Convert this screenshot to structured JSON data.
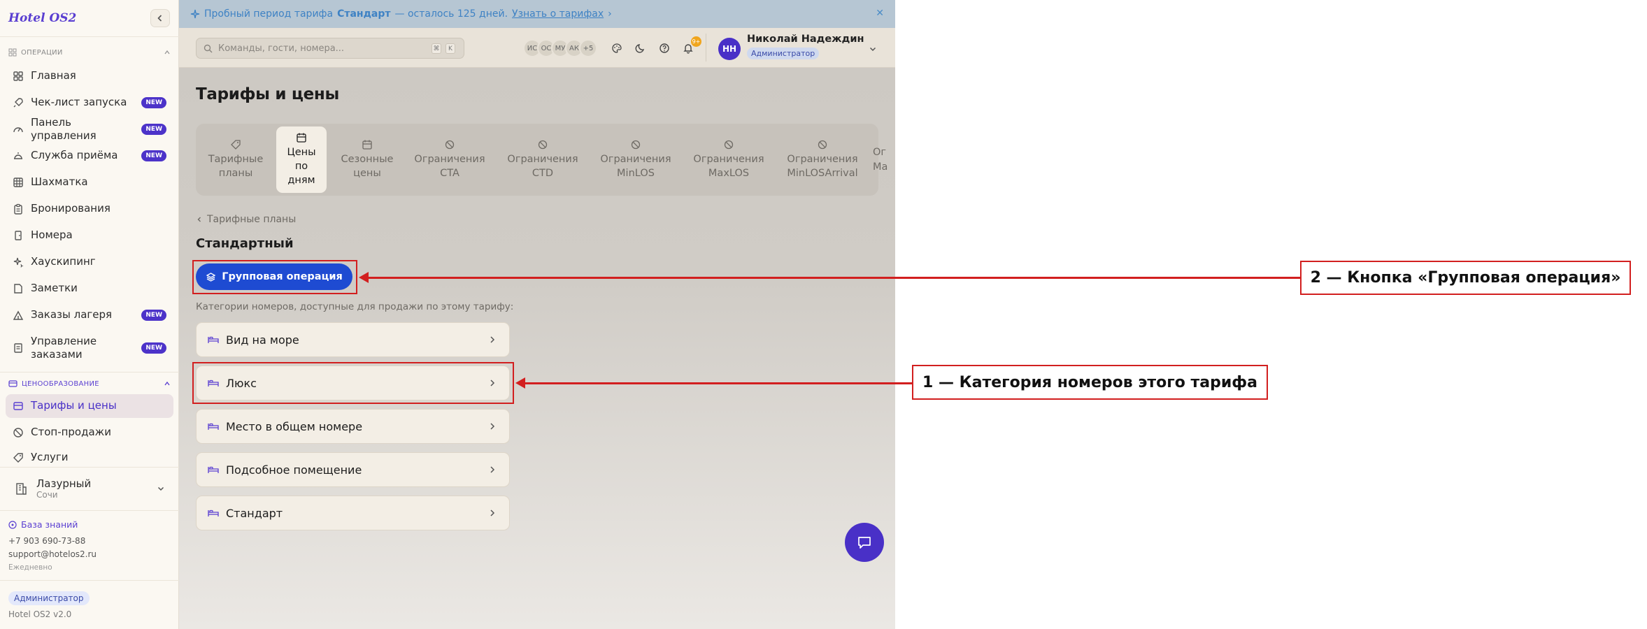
{
  "app": {
    "logo": "Hotel OS2",
    "version": "Hotel OS2 v2.0"
  },
  "sidebar": {
    "section_operations": "ОПЕРАЦИИ",
    "section_pricing": "ЦЕНООБРАЗОВАНИЕ",
    "items": [
      {
        "label": "Главная",
        "badge": "",
        "icon": "grid-icon"
      },
      {
        "label": "Чек-лист запуска",
        "badge": "NEW",
        "icon": "rocket-icon"
      },
      {
        "label": "Панель управления",
        "badge": "NEW",
        "icon": "gauge-icon"
      },
      {
        "label": "Служба приёма",
        "badge": "NEW",
        "icon": "bell-icon"
      },
      {
        "label": "Шахматка",
        "badge": "",
        "icon": "table-icon"
      },
      {
        "label": "Бронирования",
        "badge": "",
        "icon": "clipboard-icon"
      },
      {
        "label": "Номера",
        "badge": "",
        "icon": "door-icon"
      },
      {
        "label": "Хаускипинг",
        "badge": "",
        "icon": "sparkle-icon"
      },
      {
        "label": "Заметки",
        "badge": "",
        "icon": "note-icon"
      },
      {
        "label": "Заказы лагеря",
        "badge": "NEW",
        "icon": "tent-icon"
      },
      {
        "label": "Управление заказами",
        "badge": "NEW",
        "icon": "receipt-icon"
      }
    ],
    "pricing_items": [
      {
        "label": "Тарифы и цены",
        "icon": "card-icon"
      },
      {
        "label": "Стоп-продажи",
        "icon": "ban-icon"
      },
      {
        "label": "Услуги",
        "icon": "tag-icon"
      }
    ],
    "hotel": {
      "name": "Лазурный",
      "city": "Сочи"
    },
    "knowledge_base": "База знаний",
    "phone": "+7 903 690-73-88",
    "email": "support@hotelos2.ru",
    "schedule": "Ежедневно",
    "role": "Администратор"
  },
  "trial": {
    "prefix": "Пробный период тарифа",
    "plan": "Стандарт",
    "suffix": "— осталось 125 дней.",
    "link": "Узнать о тарифах"
  },
  "topbar": {
    "search_placeholder": "Команды, гости, номера...",
    "kbd1": "⌘",
    "kbd2": "K",
    "avatars": [
      "ИС",
      "ОС",
      "МУ",
      "АК",
      "+5"
    ],
    "notif_count": "9+",
    "user_initials": "НН",
    "user_name": "Николай Надеждин",
    "user_role": "Администратор"
  },
  "page": {
    "title": "Тарифы и цены",
    "tabs": [
      {
        "l1": "Тарифные",
        "l2": "планы",
        "l3": "",
        "icon": "tag-icon"
      },
      {
        "l1": "Цены",
        "l2": "по",
        "l3": "дням",
        "icon": "calendar-icon"
      },
      {
        "l1": "Сезонные",
        "l2": "цены",
        "l3": "",
        "icon": "calendar-icon"
      },
      {
        "l1": "Ограничения",
        "l2": "CTA",
        "l3": "",
        "icon": "ban-icon"
      },
      {
        "l1": "Ограничения",
        "l2": "CTD",
        "l3": "",
        "icon": "ban-icon"
      },
      {
        "l1": "Ограничения",
        "l2": "MinLOS",
        "l3": "",
        "icon": "ban-icon"
      },
      {
        "l1": "Ограничения",
        "l2": "MaxLOS",
        "l3": "",
        "icon": "ban-icon"
      },
      {
        "l1": "Ограничения",
        "l2": "MinLOSArrival",
        "l3": "",
        "icon": "ban-icon"
      },
      {
        "l1": "Ог",
        "l2": "Ма",
        "l3": "",
        "icon": ""
      }
    ],
    "breadcrumb": "Тарифные планы",
    "plan_name": "Стандартный",
    "group_button": "Групповая операция",
    "hint": "Категории номеров, доступные для продажи по этому тарифу:",
    "categories": [
      "Вид на море",
      "Люкс",
      "Место в общем номере",
      "Подсобное помещение",
      "Стандарт"
    ]
  },
  "annotations": {
    "a1": "1 — Категория номеров этого тарифа",
    "a2": "2 — Кнопка «Групповая операция»"
  },
  "colors": {
    "accent": "#4930c7",
    "primary_button": "#1e4bd2",
    "annotation": "#d21f1f"
  }
}
